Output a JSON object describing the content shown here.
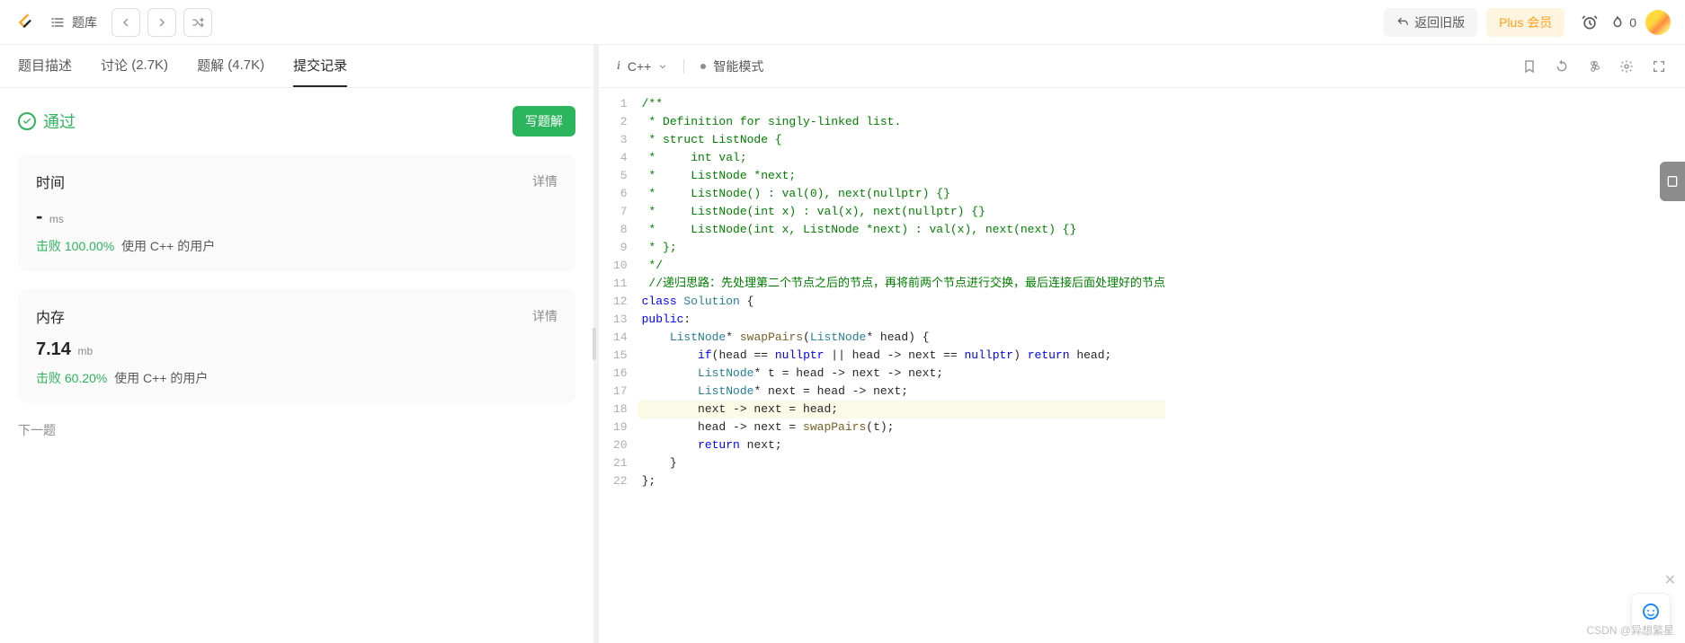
{
  "header": {
    "problems_label": "题库",
    "old_version": "返回旧版",
    "plus": "Plus 会员",
    "streak": "0"
  },
  "tabs": {
    "description": "题目描述",
    "discussion_label": "讨论",
    "discussion_count": "(2.7K)",
    "solution_label": "题解",
    "solution_count": "(4.7K)",
    "submissions": "提交记录"
  },
  "status": {
    "pass": "通过",
    "write_solution": "写题解"
  },
  "time_card": {
    "title": "时间",
    "detail": "详情",
    "value": "-",
    "unit": "ms",
    "beat_label": "击败",
    "beat_pct": "100.00%",
    "beat_suffix": "使用 C++ 的用户"
  },
  "memory_card": {
    "title": "内存",
    "detail": "详情",
    "value": "7.14",
    "unit": "mb",
    "beat_label": "击败",
    "beat_pct": "60.20%",
    "beat_suffix": "使用 C++ 的用户"
  },
  "next_problem": "下一题",
  "editor": {
    "language": "C++",
    "mode": "智能模式"
  },
  "code_lines": [
    {
      "n": 1,
      "tokens": [
        {
          "t": "/**",
          "c": "c-comment"
        }
      ]
    },
    {
      "n": 2,
      "tokens": [
        {
          "t": " * Definition for singly-linked list.",
          "c": "c-comment"
        }
      ]
    },
    {
      "n": 3,
      "tokens": [
        {
          "t": " * struct ListNode {",
          "c": "c-comment"
        }
      ]
    },
    {
      "n": 4,
      "tokens": [
        {
          "t": " *     int val;",
          "c": "c-comment"
        }
      ]
    },
    {
      "n": 5,
      "tokens": [
        {
          "t": " *     ListNode *next;",
          "c": "c-comment"
        }
      ]
    },
    {
      "n": 6,
      "tokens": [
        {
          "t": " *     ListNode() : val(0), next(nullptr) {}",
          "c": "c-comment"
        }
      ]
    },
    {
      "n": 7,
      "tokens": [
        {
          "t": " *     ListNode(int x) : val(x), next(nullptr) {}",
          "c": "c-comment"
        }
      ]
    },
    {
      "n": 8,
      "tokens": [
        {
          "t": " *     ListNode(int x, ListNode *next) : val(x), next(next) {}",
          "c": "c-comment"
        }
      ]
    },
    {
      "n": 9,
      "tokens": [
        {
          "t": " * };",
          "c": "c-comment"
        }
      ]
    },
    {
      "n": 10,
      "tokens": [
        {
          "t": " */",
          "c": "c-comment"
        }
      ]
    },
    {
      "n": 11,
      "tokens": [
        {
          "t": " //递归思路：先处理第二个节点之后的节点，再将前两个节点进行交换，最后连接后面处理好的节点",
          "c": "c-comment"
        }
      ]
    },
    {
      "n": 12,
      "tokens": [
        {
          "t": "class ",
          "c": "c-keyword"
        },
        {
          "t": "Solution",
          "c": "c-type"
        },
        {
          "t": " {",
          "c": ""
        }
      ]
    },
    {
      "n": 13,
      "tokens": [
        {
          "t": "public",
          "c": "c-keyword"
        },
        {
          "t": ":",
          "c": ""
        }
      ]
    },
    {
      "n": 14,
      "tokens": [
        {
          "t": "    ",
          "c": ""
        },
        {
          "t": "ListNode",
          "c": "c-type"
        },
        {
          "t": "* ",
          "c": ""
        },
        {
          "t": "swapPairs",
          "c": "c-func"
        },
        {
          "t": "(",
          "c": ""
        },
        {
          "t": "ListNode",
          "c": "c-type"
        },
        {
          "t": "* head) {",
          "c": ""
        }
      ]
    },
    {
      "n": 15,
      "tokens": [
        {
          "t": "        ",
          "c": ""
        },
        {
          "t": "if",
          "c": "c-keyword"
        },
        {
          "t": "(head == ",
          "c": ""
        },
        {
          "t": "nullptr",
          "c": "c-keyword"
        },
        {
          "t": " || head -> next == ",
          "c": ""
        },
        {
          "t": "nullptr",
          "c": "c-keyword"
        },
        {
          "t": ") ",
          "c": ""
        },
        {
          "t": "return",
          "c": "c-keyword"
        },
        {
          "t": " head;",
          "c": ""
        }
      ]
    },
    {
      "n": 16,
      "tokens": [
        {
          "t": "        ",
          "c": ""
        },
        {
          "t": "ListNode",
          "c": "c-type"
        },
        {
          "t": "* t = head -> next -> next;",
          "c": ""
        }
      ]
    },
    {
      "n": 17,
      "tokens": [
        {
          "t": "        ",
          "c": ""
        },
        {
          "t": "ListNode",
          "c": "c-type"
        },
        {
          "t": "* next = head -> next;",
          "c": ""
        }
      ]
    },
    {
      "n": 18,
      "hl": true,
      "tokens": [
        {
          "t": "        next -> next = head;",
          "c": ""
        }
      ]
    },
    {
      "n": 19,
      "tokens": [
        {
          "t": "        head -> next = ",
          "c": ""
        },
        {
          "t": "swapPairs",
          "c": "c-func"
        },
        {
          "t": "(t);",
          "c": ""
        }
      ]
    },
    {
      "n": 20,
      "tokens": [
        {
          "t": "        ",
          "c": ""
        },
        {
          "t": "return",
          "c": "c-keyword"
        },
        {
          "t": " next;",
          "c": ""
        }
      ]
    },
    {
      "n": 21,
      "tokens": [
        {
          "t": "    }",
          "c": ""
        }
      ]
    },
    {
      "n": 22,
      "tokens": [
        {
          "t": "};",
          "c": ""
        }
      ]
    }
  ],
  "watermark": "CSDN @异想繁星"
}
